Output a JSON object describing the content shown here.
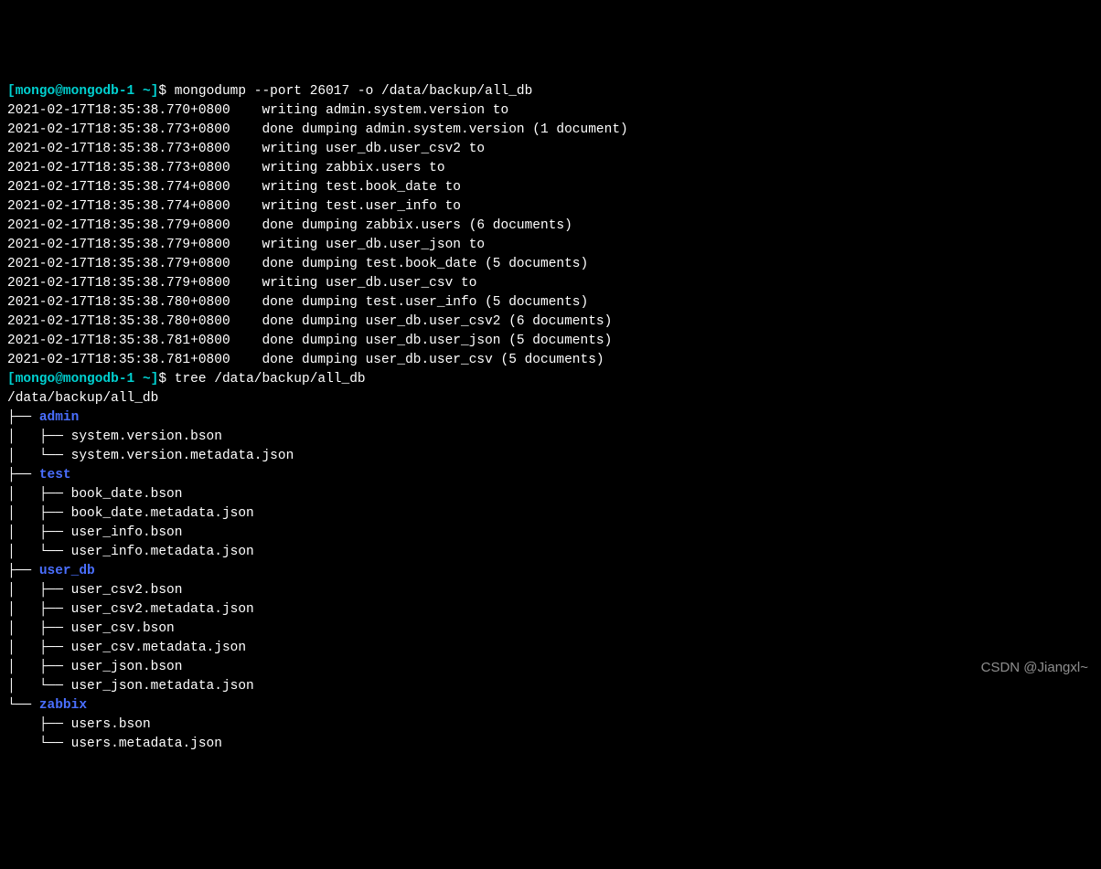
{
  "prompt": {
    "open": "[",
    "user": "mongo",
    "at": "@",
    "host": "mongodb-1",
    "sep": " ",
    "tilde": "~",
    "close": "]",
    "dollar": "$ "
  },
  "cmd1": "mongodump --port 26017 -o /data/backup/all_db",
  "dump_lines": [
    {
      "ts": "2021-02-17T18:35:38.770+0800",
      "msg": "writing admin.system.version to"
    },
    {
      "ts": "2021-02-17T18:35:38.773+0800",
      "msg": "done dumping admin.system.version (1 document)"
    },
    {
      "ts": "2021-02-17T18:35:38.773+0800",
      "msg": "writing user_db.user_csv2 to"
    },
    {
      "ts": "2021-02-17T18:35:38.773+0800",
      "msg": "writing zabbix.users to"
    },
    {
      "ts": "2021-02-17T18:35:38.774+0800",
      "msg": "writing test.book_date to"
    },
    {
      "ts": "2021-02-17T18:35:38.774+0800",
      "msg": "writing test.user_info to"
    },
    {
      "ts": "2021-02-17T18:35:38.779+0800",
      "msg": "done dumping zabbix.users (6 documents)"
    },
    {
      "ts": "2021-02-17T18:35:38.779+0800",
      "msg": "writing user_db.user_json to"
    },
    {
      "ts": "2021-02-17T18:35:38.779+0800",
      "msg": "done dumping test.book_date (5 documents)"
    },
    {
      "ts": "2021-02-17T18:35:38.779+0800",
      "msg": "writing user_db.user_csv to"
    },
    {
      "ts": "2021-02-17T18:35:38.780+0800",
      "msg": "done dumping test.user_info (5 documents)"
    },
    {
      "ts": "2021-02-17T18:35:38.780+0800",
      "msg": "done dumping user_db.user_csv2 (6 documents)"
    },
    {
      "ts": "2021-02-17T18:35:38.781+0800",
      "msg": "done dumping user_db.user_json (5 documents)"
    },
    {
      "ts": "2021-02-17T18:35:38.781+0800",
      "msg": "done dumping user_db.user_csv (5 documents)"
    }
  ],
  "cmd2": "tree /data/backup/all_db",
  "tree_root": "/data/backup/all_db",
  "tree_rows": [
    {
      "pre": "├── ",
      "name": "admin",
      "isdir": true
    },
    {
      "pre": "│   ├── ",
      "name": "system.version.bson",
      "isdir": false
    },
    {
      "pre": "│   └── ",
      "name": "system.version.metadata.json",
      "isdir": false
    },
    {
      "pre": "├── ",
      "name": "test",
      "isdir": true
    },
    {
      "pre": "│   ├── ",
      "name": "book_date.bson",
      "isdir": false
    },
    {
      "pre": "│   ├── ",
      "name": "book_date.metadata.json",
      "isdir": false
    },
    {
      "pre": "│   ├── ",
      "name": "user_info.bson",
      "isdir": false
    },
    {
      "pre": "│   └── ",
      "name": "user_info.metadata.json",
      "isdir": false
    },
    {
      "pre": "├── ",
      "name": "user_db",
      "isdir": true
    },
    {
      "pre": "│   ├── ",
      "name": "user_csv2.bson",
      "isdir": false
    },
    {
      "pre": "│   ├── ",
      "name": "user_csv2.metadata.json",
      "isdir": false
    },
    {
      "pre": "│   ├── ",
      "name": "user_csv.bson",
      "isdir": false
    },
    {
      "pre": "│   ├── ",
      "name": "user_csv.metadata.json",
      "isdir": false
    },
    {
      "pre": "│   ├── ",
      "name": "user_json.bson",
      "isdir": false
    },
    {
      "pre": "│   └── ",
      "name": "user_json.metadata.json",
      "isdir": false
    },
    {
      "pre": "└── ",
      "name": "zabbix",
      "isdir": true
    },
    {
      "pre": "    ├── ",
      "name": "users.bson",
      "isdir": false
    },
    {
      "pre": "    └── ",
      "name": "users.metadata.json",
      "isdir": false
    }
  ],
  "watermark": "CSDN @Jiangxl~"
}
